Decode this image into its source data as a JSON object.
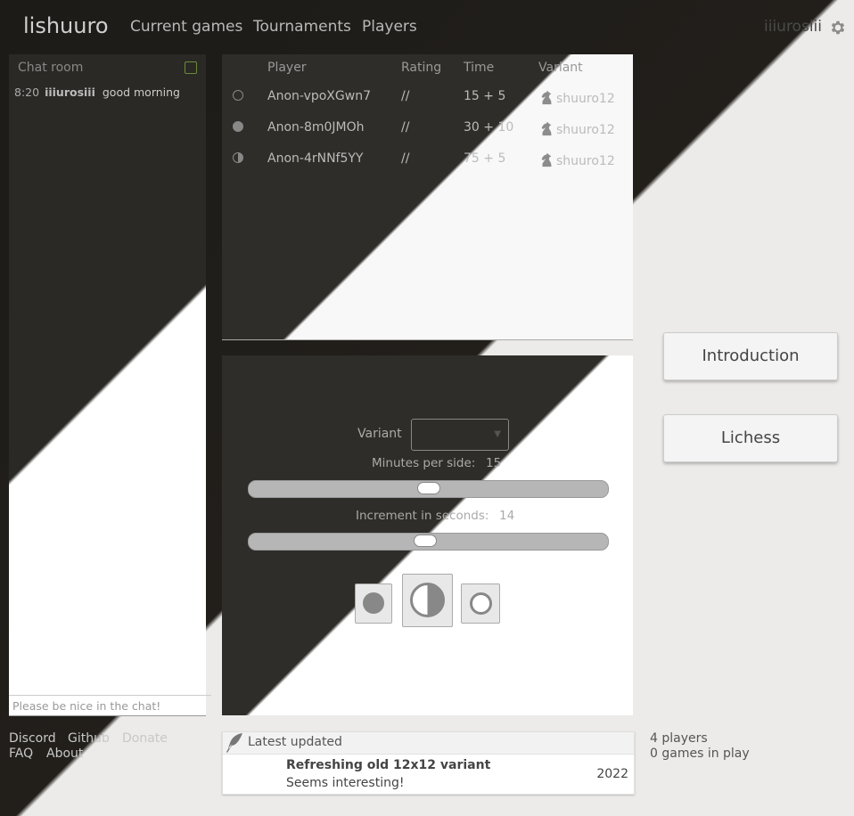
{
  "header": {
    "logo": "lishuuro",
    "nav": [
      "Current games",
      "Tournaments",
      "Players"
    ],
    "username": "iiiurosiii",
    "settings_icon": "gear-icon"
  },
  "chat": {
    "title": "Chat room",
    "messages": [
      {
        "time": "8:20",
        "user": "iiiurosiii",
        "text": "good morning"
      }
    ],
    "input_placeholder": "Please be nice in the chat!"
  },
  "seeks": {
    "headers": [
      "Player",
      "Rating",
      "Time",
      "Variant"
    ],
    "rows": [
      {
        "color": "white",
        "player": "Anon-vpoXGwn7",
        "rating": "//",
        "time": "15 + 5",
        "variant": "shuuro12"
      },
      {
        "color": "black",
        "player": "Anon-8m0JMOh",
        "rating": "//",
        "time": "30 + 10",
        "variant": "shuuro12"
      },
      {
        "color": "random",
        "player": "Anon-4rNNf5YY",
        "rating": "//",
        "time": "75 + 5",
        "variant": "shuuro12"
      }
    ]
  },
  "create": {
    "variant_label": "Variant",
    "variant_value": "",
    "minutes_label": "Minutes per side:",
    "minutes_value": "15",
    "minutes_fraction": 0.5,
    "increment_label": "Increment in seconds:",
    "increment_value": "14",
    "increment_fraction": 0.49,
    "color_buttons": [
      "black",
      "random",
      "white"
    ]
  },
  "side_buttons": {
    "introduction": "Introduction",
    "lichess": "Lichess"
  },
  "footer": {
    "links_row1": [
      "Discord",
      "Github",
      "Donate"
    ],
    "links_row2": [
      "FAQ",
      "About"
    ]
  },
  "news": {
    "header": "Latest updated",
    "item_title": "Refreshing old 12x12 variant",
    "item_desc": "Seems interesting!",
    "item_year": "2022"
  },
  "stats": {
    "players": "4 players",
    "games": "0 games in play"
  }
}
